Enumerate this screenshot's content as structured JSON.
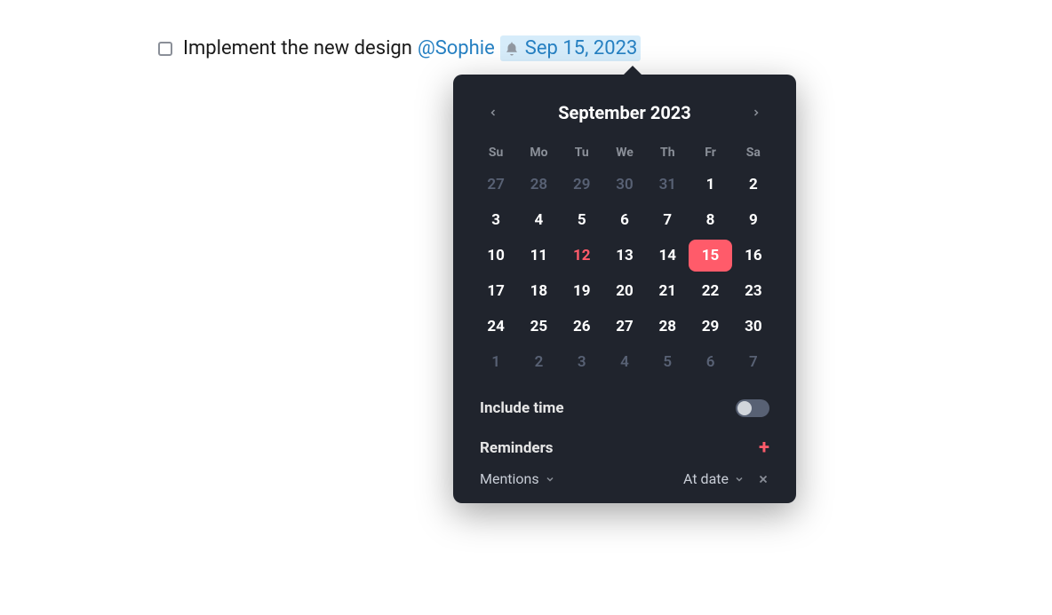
{
  "task": {
    "text": "Implement the new design",
    "mention": "@Sophie",
    "date_label": "Sep 15, 2023"
  },
  "calendar": {
    "title": "September 2023",
    "weekdays": [
      "Su",
      "Mo",
      "Tu",
      "We",
      "Th",
      "Fr",
      "Sa"
    ],
    "today_day": 12,
    "selected_day": 15,
    "days": [
      {
        "n": 27,
        "other": true
      },
      {
        "n": 28,
        "other": true
      },
      {
        "n": 29,
        "other": true
      },
      {
        "n": 30,
        "other": true
      },
      {
        "n": 31,
        "other": true
      },
      {
        "n": 1
      },
      {
        "n": 2
      },
      {
        "n": 3
      },
      {
        "n": 4
      },
      {
        "n": 5
      },
      {
        "n": 6
      },
      {
        "n": 7
      },
      {
        "n": 8
      },
      {
        "n": 9
      },
      {
        "n": 10
      },
      {
        "n": 11
      },
      {
        "n": 12
      },
      {
        "n": 13
      },
      {
        "n": 14
      },
      {
        "n": 15
      },
      {
        "n": 16
      },
      {
        "n": 17
      },
      {
        "n": 18
      },
      {
        "n": 19
      },
      {
        "n": 20
      },
      {
        "n": 21
      },
      {
        "n": 22
      },
      {
        "n": 23
      },
      {
        "n": 24
      },
      {
        "n": 25
      },
      {
        "n": 26
      },
      {
        "n": 27
      },
      {
        "n": 28
      },
      {
        "n": 29
      },
      {
        "n": 30
      },
      {
        "n": 1,
        "other": true
      },
      {
        "n": 2,
        "other": true
      },
      {
        "n": 3,
        "other": true
      },
      {
        "n": 4,
        "other": true
      },
      {
        "n": 5,
        "other": true
      },
      {
        "n": 6,
        "other": true
      },
      {
        "n": 7,
        "other": true
      }
    ]
  },
  "options": {
    "include_time_label": "Include time",
    "include_time_on": false,
    "reminders_label": "Reminders",
    "reminder_type": "Mentions",
    "reminder_timing": "At date"
  },
  "colors": {
    "accent": "#ff5b6a",
    "link": "#2680c2",
    "panel_bg": "#20242d",
    "muted": "#8a8f98"
  }
}
